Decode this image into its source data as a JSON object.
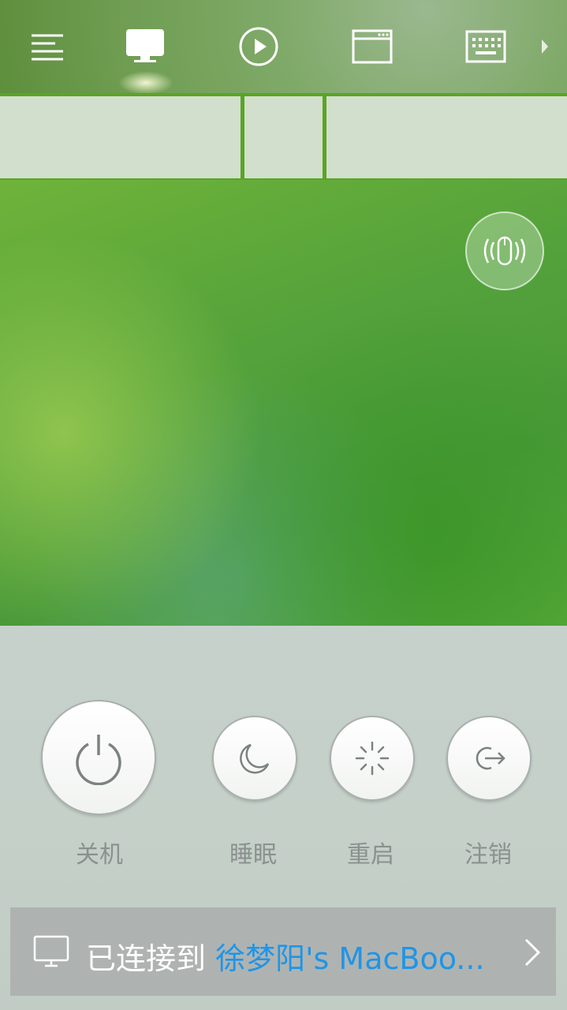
{
  "toolbar": {
    "items": [
      {
        "icon": "menu-icon"
      },
      {
        "icon": "monitor-icon",
        "active": true
      },
      {
        "icon": "play-icon"
      },
      {
        "icon": "window-icon"
      },
      {
        "icon": "keyboard-icon"
      },
      {
        "icon": "chevron-right-icon"
      }
    ]
  },
  "colors": {
    "accent_green": "#5aa426",
    "link_blue": "#1f95e6",
    "label_gray": "#8b918f"
  },
  "power": {
    "shutdown_label": "关机",
    "sleep_label": "睡眠",
    "restart_label": "重启",
    "logout_label": "注销"
  },
  "status": {
    "prefix": "已连接到 ",
    "device_name": "徐梦阳's MacBoo..."
  }
}
